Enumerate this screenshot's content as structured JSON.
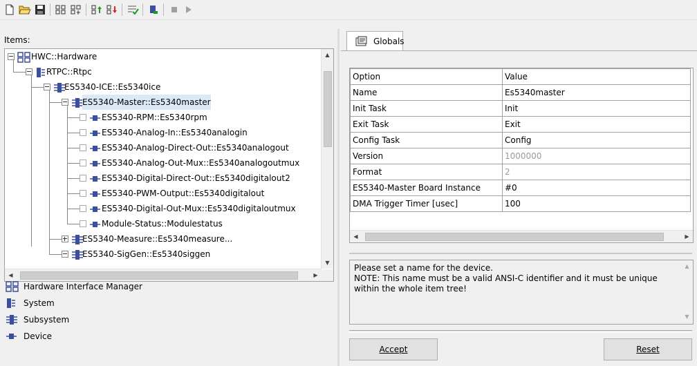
{
  "toolbar": {
    "buttons": [
      {
        "name": "new-icon"
      },
      {
        "name": "open-icon"
      },
      {
        "name": "save-icon"
      },
      {
        "name": "add-subsystem-icon"
      },
      {
        "name": "add-device-icon"
      },
      {
        "name": "move-up-icon"
      },
      {
        "name": "move-down-icon"
      },
      {
        "name": "check-icon"
      },
      {
        "name": "run-icon"
      },
      {
        "name": "stop-icon"
      },
      {
        "name": "play-icon"
      }
    ]
  },
  "left": {
    "items_label": "Items:",
    "tree": [
      {
        "label": "HWC::Hardware",
        "level": 0,
        "icon": "hardware-icon",
        "expander": "minus"
      },
      {
        "label": "RTPC::Rtpc",
        "level": 1,
        "icon": "system-icon",
        "expander": "minus"
      },
      {
        "label": "ES5340-ICE::Es5340ice",
        "level": 2,
        "icon": "subsystem-icon",
        "expander": "minus"
      },
      {
        "label": "ES5340-Master::Es5340master",
        "level": 3,
        "icon": "subsystem-icon",
        "expander": "minus",
        "selected": true
      },
      {
        "label": "ES5340-RPM::Es5340rpm",
        "level": 4,
        "icon": "device-icon",
        "expander": "check"
      },
      {
        "label": "ES5340-Analog-In::Es5340analogin",
        "level": 4,
        "icon": "device-icon",
        "expander": "check"
      },
      {
        "label": "ES5340-Analog-Direct-Out::Es5340analogout",
        "level": 4,
        "icon": "device-icon",
        "expander": "check"
      },
      {
        "label": "ES5340-Analog-Out-Mux::Es5340analogoutmux",
        "level": 4,
        "icon": "device-icon",
        "expander": "check"
      },
      {
        "label": "ES5340-Digital-Direct-Out::Es5340digitalout2",
        "level": 4,
        "icon": "device-icon",
        "expander": "check"
      },
      {
        "label": "ES5340-PWM-Output::Es5340digitalout",
        "level": 4,
        "icon": "device-icon",
        "expander": "check"
      },
      {
        "label": "ES5340-Digital-Out-Mux::Es5340digitaloutmux",
        "level": 4,
        "icon": "device-icon",
        "expander": "check"
      },
      {
        "label": "Module-Status::Modulestatus",
        "level": 4,
        "icon": "device-icon",
        "expander": "check"
      },
      {
        "label": "ES5340-Measure::Es5340measure...",
        "level": 3,
        "icon": "subsystem-icon",
        "expander": "plus"
      },
      {
        "label": "ES5340-SigGen::Es5340siggen",
        "level": 3,
        "icon": "subsystem-icon",
        "expander": "minus"
      }
    ],
    "legend": [
      {
        "label": "Hardware Interface Manager",
        "icon": "hardware-icon"
      },
      {
        "label": "System",
        "icon": "system-icon"
      },
      {
        "label": "Subsystem",
        "icon": "subsystem-icon"
      },
      {
        "label": "Device",
        "icon": "device-icon"
      }
    ]
  },
  "right": {
    "tab_label": "Globals",
    "grid": {
      "headers": [
        "Option",
        "Value"
      ],
      "rows": [
        {
          "option": "Name",
          "value": "Es5340master",
          "disabled": false
        },
        {
          "option": "Init Task",
          "value": "Init",
          "disabled": false
        },
        {
          "option": "Exit Task",
          "value": "Exit",
          "disabled": false
        },
        {
          "option": "Config Task",
          "value": "Config",
          "disabled": false
        },
        {
          "option": "Version",
          "value": "1000000",
          "disabled": true
        },
        {
          "option": "Format",
          "value": "2",
          "disabled": true
        },
        {
          "option": "ES5340-Master Board Instance",
          "value": "#0",
          "disabled": false
        },
        {
          "option": "DMA Trigger Timer [usec]",
          "value": "100",
          "disabled": false
        }
      ]
    },
    "info_line1": "Please set a name for the device.",
    "info_line2": "NOTE: This name must be a valid ANSI-C identifier and it must be unique within the whole item tree!",
    "accept_label": "Accept",
    "reset_label": "Reset"
  },
  "colors": {
    "selection": "#dbe8f7",
    "icon_blue": "#3b4f9e",
    "border": "#a0a0a0"
  }
}
